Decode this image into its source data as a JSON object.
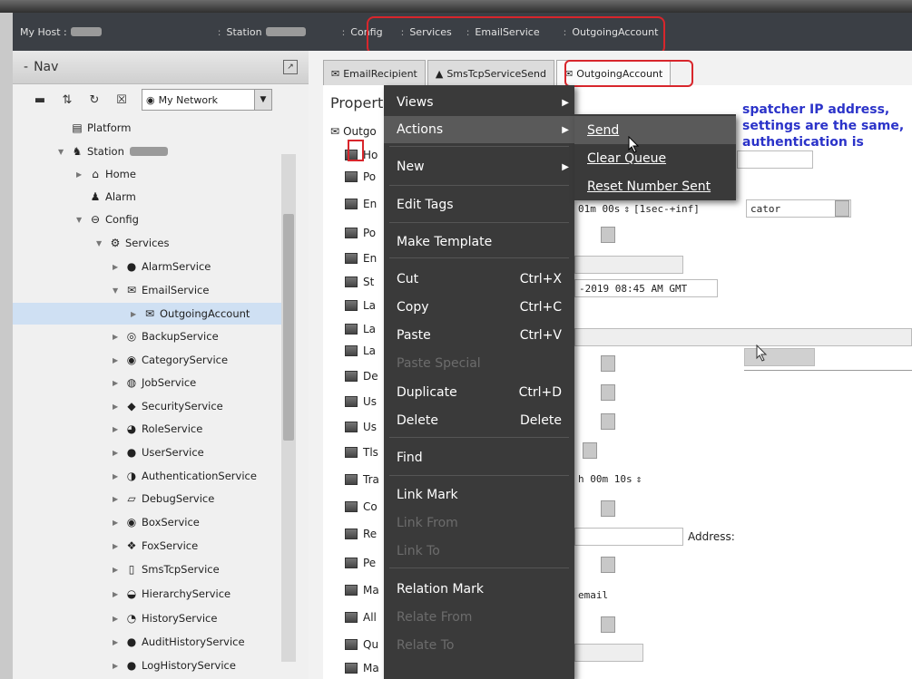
{
  "breadcrumb": {
    "host_label": "My Host :",
    "station_label": "Station",
    "items": [
      "Config",
      "Services",
      "EmailService",
      "OutgoingAccount"
    ]
  },
  "nav": {
    "title": "Nav",
    "network_select": "My Network",
    "tree": [
      {
        "label": "Platform",
        "icon": "platform-icon"
      },
      {
        "label": "Station",
        "icon": "station-icon"
      },
      {
        "label": "Home",
        "icon": "home-icon"
      },
      {
        "label": "Alarm",
        "icon": "alarm-bell-icon"
      },
      {
        "label": "Config",
        "icon": "config-icon"
      },
      {
        "label": "Services",
        "icon": "services-icon"
      },
      {
        "label": "AlarmService",
        "icon": "service-icon"
      },
      {
        "label": "EmailService",
        "icon": "email-icon"
      },
      {
        "label": "OutgoingAccount",
        "icon": "outgoing-account-icon"
      },
      {
        "label": "BackupService",
        "icon": "backup-icon"
      },
      {
        "label": "CategoryService",
        "icon": "category-icon"
      },
      {
        "label": "JobService",
        "icon": "job-icon"
      },
      {
        "label": "SecurityService",
        "icon": "security-icon"
      },
      {
        "label": "RoleService",
        "icon": "role-icon"
      },
      {
        "label": "UserService",
        "icon": "user-icon"
      },
      {
        "label": "AuthenticationService",
        "icon": "authentication-icon"
      },
      {
        "label": "DebugService",
        "icon": "debug-icon"
      },
      {
        "label": "BoxService",
        "icon": "box-icon"
      },
      {
        "label": "FoxService",
        "icon": "fox-icon"
      },
      {
        "label": "SmsTcpService",
        "icon": "sms-icon"
      },
      {
        "label": "HierarchyService",
        "icon": "hierarchy-icon"
      },
      {
        "label": "HistoryService",
        "icon": "history-icon"
      },
      {
        "label": "AuditHistoryService",
        "icon": "audit-icon"
      },
      {
        "label": "LogHistoryService",
        "icon": "log-icon"
      }
    ]
  },
  "tabs": [
    "EmailRecipient",
    "SmsTcpServiceSend",
    "OutgoingAccount"
  ],
  "property_sheet": {
    "title": "Propert",
    "root_label": "Outgo",
    "rows": [
      "Ho",
      "Po",
      "En",
      "Po",
      "En",
      "St",
      "La",
      "La",
      "La",
      "De",
      "Us",
      "Us",
      "Tls",
      "Tra",
      "Co",
      "Re",
      "Pe",
      "Ma",
      "All",
      "Qu",
      "Ma"
    ],
    "values": {
      "timer": "01m 00s",
      "range": "[1sec-+inf]",
      "locator": "cator",
      "date": "-2019 08:45 AM GMT",
      "timer2": "h 00m 10s",
      "address_label": "Address:",
      "email": "email"
    }
  },
  "note": {
    "lines": [
      "spatcher IP address,",
      "settings are the same,",
      "authentication is"
    ]
  },
  "context_menu": {
    "items": [
      {
        "label": "Views",
        "submenu": true
      },
      {
        "label": "Actions",
        "submenu": true,
        "highlighted": true
      },
      {
        "label": "New",
        "submenu": true
      },
      {
        "label": "Edit Tags"
      },
      {
        "label": "Make Template"
      },
      {
        "label": "Cut",
        "shortcut": "Ctrl+X"
      },
      {
        "label": "Copy",
        "shortcut": "Ctrl+C"
      },
      {
        "label": "Paste",
        "shortcut": "Ctrl+V"
      },
      {
        "label": "Paste Special",
        "disabled": true
      },
      {
        "label": "Duplicate",
        "shortcut": "Ctrl+D"
      },
      {
        "label": "Delete",
        "shortcut": "Delete"
      },
      {
        "label": "Find"
      },
      {
        "label": "Link Mark"
      },
      {
        "label": "Link From",
        "disabled": true
      },
      {
        "label": "Link To",
        "disabled": true
      },
      {
        "label": "Relation Mark"
      },
      {
        "label": "Relate From",
        "disabled": true
      },
      {
        "label": "Relate To",
        "disabled": true
      }
    ]
  },
  "actions_submenu": {
    "items": [
      "Send",
      "Clear Queue",
      "Reset Number Sent"
    ]
  },
  "colors": {
    "highlight_box": "#d8262c",
    "note_text": "#2b33c9",
    "menu_bg": "#3a3a3a"
  }
}
